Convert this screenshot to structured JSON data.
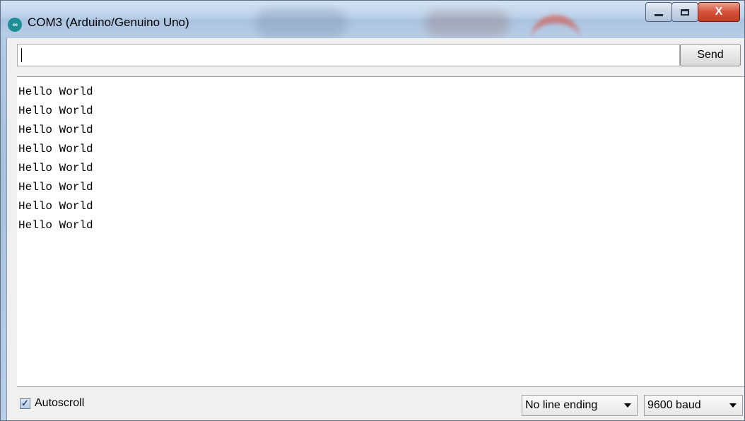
{
  "window": {
    "title": "COM3 (Arduino/Genuino Uno)",
    "icon_text": "∞",
    "close_symbol": "X"
  },
  "send_row": {
    "input_value": "",
    "send_label": "Send"
  },
  "output": {
    "lines": [
      "Hello World",
      "Hello World",
      "Hello World",
      "Hello World",
      "Hello World",
      "Hello World",
      "Hello World",
      "Hello World"
    ]
  },
  "bottom": {
    "autoscroll_label": "Autoscroll",
    "autoscroll_checked": true,
    "line_ending": "No line ending",
    "baud_rate": "9600 baud"
  },
  "colors": {
    "titlebar": "#b9cfe8",
    "close_button": "#c23b22",
    "arduino_teal": "#1f8f97"
  }
}
